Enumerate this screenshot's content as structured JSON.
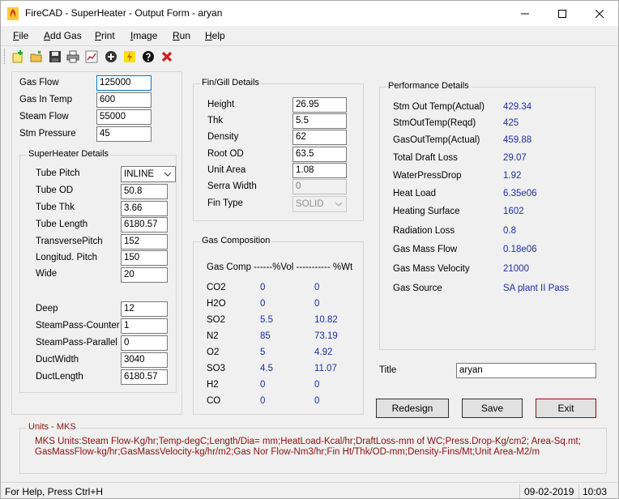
{
  "window": {
    "title": "FireCAD - SuperHeater - Output Form - aryan"
  },
  "menu": {
    "items": [
      {
        "label": "File",
        "u": "F",
        "rest": "ile"
      },
      {
        "label": "Add Gas",
        "u": "A",
        "rest": "dd Gas"
      },
      {
        "label": "Print",
        "u": "P",
        "rest": "rint"
      },
      {
        "label": "Image",
        "u": "I",
        "rest": "mage"
      },
      {
        "label": "Run",
        "u": "R",
        "rest": "un"
      },
      {
        "label": "Help",
        "u": "H",
        "rest": "elp"
      }
    ]
  },
  "toolbar": {
    "icons": [
      "new-icon",
      "open-folder-icon",
      "save-icon",
      "print-icon",
      "chart-icon",
      "add-gas-icon",
      "run-icon",
      "help-icon",
      "close-icon"
    ]
  },
  "inputs": {
    "gas_flow": {
      "label": "Gas Flow",
      "value": "125000"
    },
    "gas_in_temp": {
      "label": "Gas In Temp",
      "value": "600"
    },
    "steam_flow": {
      "label": "Steam Flow",
      "value": "55000"
    },
    "stm_pressure": {
      "label": "Stm Pressure",
      "value": "45"
    }
  },
  "superheater": {
    "title": "SuperHeater Details",
    "tube_pitch": {
      "label": "Tube Pitch",
      "value": "INLINE"
    },
    "tube_od": {
      "label": "Tube OD",
      "value": "50.8"
    },
    "tube_thk": {
      "label": "Tube Thk",
      "value": "3.66"
    },
    "tube_length": {
      "label": "Tube Length",
      "value": "6180.57"
    },
    "transverse_pitch": {
      "label": "TransversePitch",
      "value": "152"
    },
    "longitud_pitch": {
      "label": "Longitud. Pitch",
      "value": "150"
    },
    "wide": {
      "label": "Wide",
      "value": "20"
    },
    "deep": {
      "label": "Deep",
      "value": "12"
    },
    "steampass_counter": {
      "label": "SteamPass-Counter",
      "value": "1"
    },
    "steampass_parallel": {
      "label": "SteamPass-Parallel",
      "value": "0"
    },
    "duct_width": {
      "label": "DuctWidth",
      "value": "3040"
    },
    "duct_length": {
      "label": "DuctLength",
      "value": "6180.57"
    }
  },
  "fin": {
    "title": "Fin/Gill Details",
    "height": {
      "label": "Height",
      "value": "26.95"
    },
    "thk": {
      "label": "Thk",
      "value": "5.5"
    },
    "density": {
      "label": "Density",
      "value": "62"
    },
    "root_od": {
      "label": "Root OD",
      "value": "63.5"
    },
    "unit_area": {
      "label": "Unit Area",
      "value": "1.08"
    },
    "serra_width": {
      "label": "Serra Width",
      "value": "0"
    },
    "fin_type": {
      "label": "Fin Type",
      "value": "SOLID"
    }
  },
  "gas_composition": {
    "title": "Gas Composition",
    "header": "Gas Comp ------%Vol ----------- %Wt",
    "rows": [
      {
        "name": "CO2",
        "vol": "0",
        "wt": "0"
      },
      {
        "name": "H2O",
        "vol": "0",
        "wt": "0"
      },
      {
        "name": "SO2",
        "vol": "5.5",
        "wt": "10.82"
      },
      {
        "name": "N2",
        "vol": "85",
        "wt": "73.19"
      },
      {
        "name": "O2",
        "vol": "5",
        "wt": "4.92"
      },
      {
        "name": "SO3",
        "vol": "4.5",
        "wt": "11.07"
      },
      {
        "name": "H2",
        "vol": "0",
        "wt": "0"
      },
      {
        "name": "CO",
        "vol": "0",
        "wt": "0"
      }
    ]
  },
  "performance": {
    "title": "Performance Details",
    "rows": [
      {
        "label": "Stm Out Temp(Actual)",
        "value": "429.34"
      },
      {
        "label": "StmOutTemp(Reqd)",
        "value": "425"
      },
      {
        "label": "GasOutTemp(Actual)",
        "value": "459.88"
      },
      {
        "label": "Total Draft Loss",
        "value": "29.07"
      },
      {
        "label": "WaterPressDrop",
        "value": "1.92"
      },
      {
        "label": "Heat Load",
        "value": "6.35e06"
      },
      {
        "label": "Heating Surface",
        "value": "1602"
      },
      {
        "label": "Radiation Loss",
        "value": "0.8"
      },
      {
        "label": "Gas Mass Flow",
        "value": "0.18e06"
      },
      {
        "label": "Gas Mass Velocity",
        "value": "21000"
      },
      {
        "label": "Gas Source",
        "value": "SA plant II Pass"
      }
    ]
  },
  "title_field": {
    "label": "Title",
    "value": "aryan"
  },
  "buttons": {
    "redesign": "Redesign",
    "save": "Save",
    "exit": "Exit"
  },
  "units": {
    "title": "Units - MKS",
    "text": "MKS Units:Steam Flow-Kg/hr;Temp-degC;Length/Dia= mm;HeatLoad-Kcal/hr;DraftLoss-mm of WC;Press.Drop-Kg/cm2; Area-Sq.mt; GasMassFlow-kg/hr;GasMassVelocity-kg/hr/m2;Gas Nor Flow-Nm3/hr;Fin Ht/Thk/OD-mm;Density-Fins/Mt;Unit Area-M2/m"
  },
  "status": {
    "help": "For Help, Press Ctrl+H",
    "date": "09-02-2019",
    "time": "10:03"
  },
  "colors": {
    "value_text": "#1f2f9f",
    "units_text": "#8b1010",
    "focus_border": "#0078d7"
  }
}
